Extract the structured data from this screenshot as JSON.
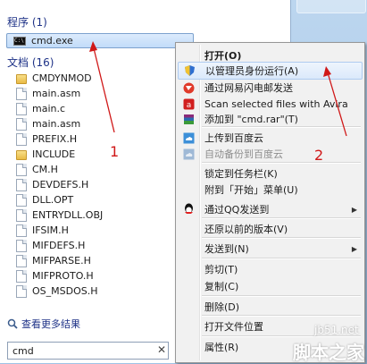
{
  "programs": {
    "heading": "程序 (1)",
    "items": [
      {
        "label": "cmd.exe",
        "icon": "cmd-icon"
      }
    ]
  },
  "documents": {
    "heading": "文档 (16)",
    "items": [
      {
        "label": "CMDYNMOD",
        "icon": "folder-icon"
      },
      {
        "label": "main.asm",
        "icon": "file-icon"
      },
      {
        "label": "main.c",
        "icon": "file-icon"
      },
      {
        "label": "main.asm",
        "icon": "file-icon"
      },
      {
        "label": "PREFIX.H",
        "icon": "file-icon"
      },
      {
        "label": "INCLUDE",
        "icon": "folder-icon"
      },
      {
        "label": "CM.H",
        "icon": "file-icon"
      },
      {
        "label": "DEVDEFS.H",
        "icon": "file-icon"
      },
      {
        "label": "DLL.OPT",
        "icon": "file-icon"
      },
      {
        "label": "ENTRYDLL.OBJ",
        "icon": "file-icon"
      },
      {
        "label": "IFSIM.H",
        "icon": "file-icon"
      },
      {
        "label": "MIFDEFS.H",
        "icon": "file-icon"
      },
      {
        "label": "MIFPARSE.H",
        "icon": "file-icon"
      },
      {
        "label": "MIFPROTO.H",
        "icon": "file-icon"
      },
      {
        "label": "OS_MSDOS.H",
        "icon": "file-icon"
      }
    ]
  },
  "see_more": "查看更多结果",
  "search": {
    "value": "cmd",
    "clear": "✕"
  },
  "context_menu": {
    "items": [
      {
        "label": "打开(O)",
        "icon": "",
        "bold": true
      },
      {
        "label": "以管理员身份运行(A)",
        "icon": "shield-icon",
        "hover": true
      },
      {
        "label": "通过网易闪电邮发送",
        "icon": "mail-icon"
      },
      {
        "label": "Scan selected files with Avira",
        "icon": "avira-icon"
      },
      {
        "label": "添加到 \"cmd.rar\"(T)",
        "icon": "winrar-icon"
      },
      {
        "label": "上传到百度云",
        "icon": "cloud-icon"
      },
      {
        "label": "自动备份到百度云",
        "icon": "backup-icon",
        "disabled": true
      },
      {
        "label": "锁定到任务栏(K)",
        "icon": ""
      },
      {
        "label": "附到「开始」菜单(U)",
        "icon": ""
      },
      {
        "label": "通过QQ发送到",
        "icon": "qq-icon",
        "submenu": true
      },
      {
        "label": "还原以前的版本(V)",
        "icon": ""
      },
      {
        "label": "发送到(N)",
        "icon": "",
        "submenu": true
      },
      {
        "label": "剪切(T)",
        "icon": ""
      },
      {
        "label": "复制(C)",
        "icon": ""
      },
      {
        "label": "删除(D)",
        "icon": ""
      },
      {
        "label": "打开文件位置",
        "icon": ""
      },
      {
        "label": "属性(R)",
        "icon": ""
      }
    ]
  },
  "annotations": {
    "label1": "1",
    "label2": "2"
  },
  "watermark": {
    "line1": "jb51.net",
    "line2": "脚本之家"
  },
  "colors": {
    "annotation": "#d01818",
    "heading": "#1e3287"
  }
}
